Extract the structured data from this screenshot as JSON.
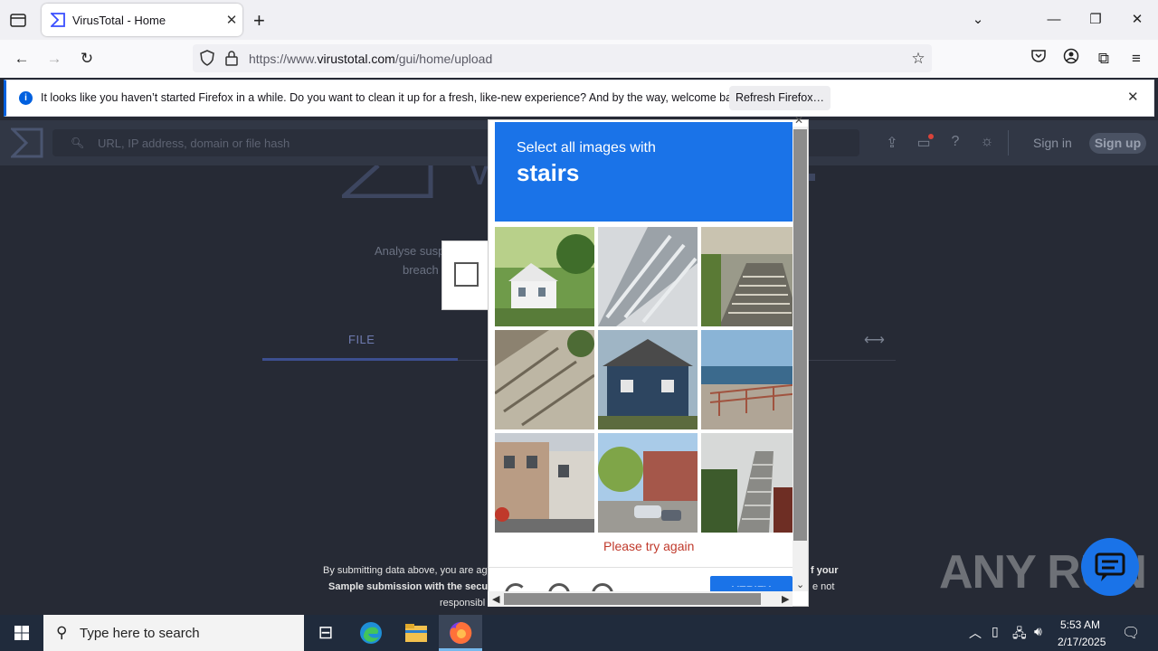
{
  "browser": {
    "tab_title": "VirusTotal - Home",
    "url_prefix": "https://www.",
    "url_domain": "virustotal.com",
    "url_path": "/gui/home/upload",
    "notification_text": "It looks like you haven’t started Firefox in a while. Do you want to clean it up for a fresh, like-new experience? And by the way, welcome back!",
    "refresh_label": "Refresh Firefox…"
  },
  "vt": {
    "search_placeholder": "URL, IP address, domain or file hash",
    "signin": "Sign in",
    "signup": "Sign up",
    "tagline1": "Analyse susp",
    "tagline2": "breach",
    "tab_file": "FILE",
    "terms1": "By submitting data above, you are ag",
    "terms2": "Sample submission with the secur",
    "terms3": "responsibl",
    "terms_r1": "f your",
    "terms_r2": "e not"
  },
  "captcha": {
    "line1": "Select all images with",
    "line2": "stairs",
    "message": "Please try again",
    "verify_label": "VERIFY"
  },
  "watermark": "ANY RUN",
  "taskbar": {
    "search_placeholder": "Type here to search",
    "time": "5:53 AM",
    "date": "2/17/2025"
  },
  "colors": {
    "captcha_blue": "#1a73e8",
    "vt_bg": "#262a35",
    "firefox_tab_bg": "#f0f0f4"
  }
}
